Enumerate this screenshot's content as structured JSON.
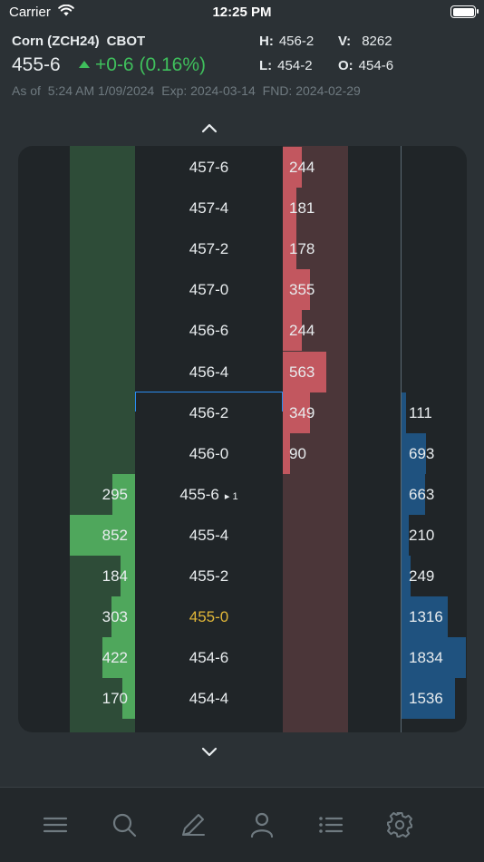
{
  "status_bar": {
    "carrier": "Carrier",
    "time": "12:25 PM"
  },
  "header": {
    "name": "Corn (ZCH24)",
    "exchange": "CBOT",
    "last_price": "455-6",
    "change": "+0-6 (0.16%)",
    "high_label": "H:",
    "high": "456-2",
    "volume_label": "V:",
    "volume": "8262",
    "low_label": "L:",
    "low": "454-2",
    "open_label": "O:",
    "open": "454-6",
    "as_of_label": "As of",
    "as_of": "5:24 AM 1/09/2024",
    "expiry": "Exp: 2024-03-14",
    "fnd": "FND: 2024-02-29"
  },
  "colors": {
    "positive": "#3fbf5c",
    "bid": "#4fa75c",
    "ask": "#c2575f",
    "volume": "#1f527f",
    "last_trade_price": "#e0b638",
    "cursor": "#2a8cf0"
  },
  "ladder": {
    "rows": [
      {
        "price": "457-6",
        "bid": "",
        "ask": "244",
        "volume": "",
        "marker": ""
      },
      {
        "price": "457-4",
        "bid": "",
        "ask": "181",
        "volume": "",
        "marker": ""
      },
      {
        "price": "457-2",
        "bid": "",
        "ask": "178",
        "volume": "",
        "marker": ""
      },
      {
        "price": "457-0",
        "bid": "",
        "ask": "355",
        "volume": "",
        "marker": ""
      },
      {
        "price": "456-6",
        "bid": "",
        "ask": "244",
        "volume": "",
        "marker": ""
      },
      {
        "price": "456-4",
        "bid": "",
        "ask": "563",
        "volume": "",
        "marker": ""
      },
      {
        "price": "456-2",
        "bid": "",
        "ask": "349",
        "volume": "111",
        "marker": ""
      },
      {
        "price": "456-0",
        "bid": "",
        "ask": "90",
        "volume": "693",
        "marker": ""
      },
      {
        "price": "455-6",
        "bid": "295",
        "ask": "",
        "volume": "663",
        "marker": "▸ 1"
      },
      {
        "price": "455-4",
        "bid": "852",
        "ask": "",
        "volume": "210",
        "marker": ""
      },
      {
        "price": "455-2",
        "bid": "184",
        "ask": "",
        "volume": "249",
        "marker": ""
      },
      {
        "price": "455-0",
        "bid": "303",
        "ask": "",
        "volume": "1316",
        "marker": ""
      },
      {
        "price": "454-6",
        "bid": "422",
        "ask": "",
        "volume": "1834",
        "marker": ""
      },
      {
        "price": "454-4",
        "bid": "170",
        "ask": "",
        "volume": "1536",
        "marker": ""
      }
    ],
    "last_trade_price": "455-0",
    "cursor_price": "456-2"
  },
  "icons": {
    "up": "chevron-up-icon",
    "down": "chevron-down-icon",
    "tabs": [
      "menu-icon",
      "search-icon",
      "pencil-icon",
      "user-icon",
      "list-icon",
      "gear-icon"
    ]
  }
}
